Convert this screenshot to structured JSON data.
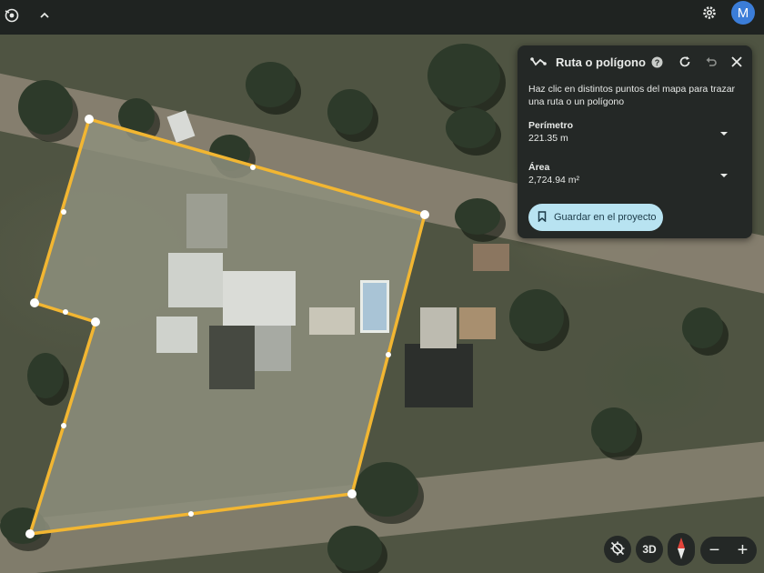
{
  "topbar": {
    "account_initial": "M",
    "icons": [
      "compass-logo-icon",
      "chevron-up-icon",
      "gear-icon"
    ]
  },
  "panel": {
    "title": "Ruta o polígono",
    "instructions": "Haz clic en distintos puntos del mapa para trazar una ruta o un polígono",
    "perimeter_label": "Perímetro",
    "perimeter_value": "221.35 m",
    "area_label": "Área",
    "area_value": "2,724.94 m²",
    "save_label": "Guardar en el proyecto",
    "icons": [
      "route-icon",
      "help-icon",
      "refresh-icon",
      "undo-icon",
      "close-icon",
      "bookmark-icon"
    ]
  },
  "controls": {
    "view_label": "3D",
    "zoom_out": "−",
    "zoom_in": "+"
  },
  "colors": {
    "polygon_stroke": "#f2b632",
    "panel_bg": "#242826",
    "save_button_bg": "#b8e3f1",
    "avatar_bg": "#3b7dd8"
  }
}
